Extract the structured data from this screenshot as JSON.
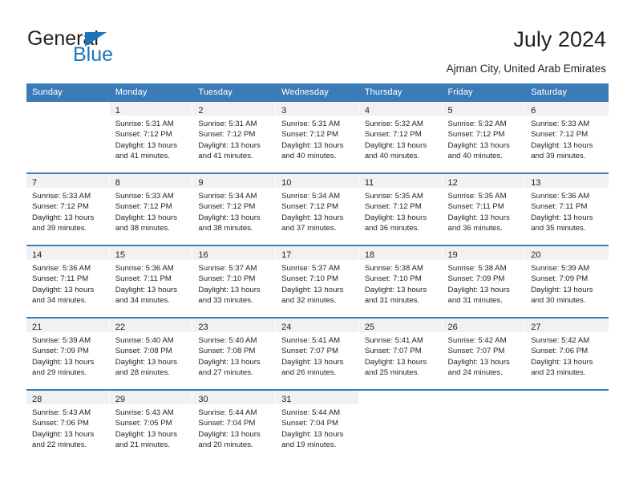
{
  "brand": {
    "name_top": "General",
    "name_bottom": "Blue",
    "accent_color": "#1b75bc"
  },
  "header": {
    "title": "July 2024",
    "subtitle": "Ajman City, United Arab Emirates"
  },
  "calendar": {
    "header_bg": "#3b7cb8",
    "daynum_bg": "#f1f1f1",
    "weekdays": [
      "Sunday",
      "Monday",
      "Tuesday",
      "Wednesday",
      "Thursday",
      "Friday",
      "Saturday"
    ],
    "weeks": [
      [
        {
          "day": "",
          "sunrise": "",
          "sunset": "",
          "daylight_line1": "",
          "daylight_line2": ""
        },
        {
          "day": "1",
          "sunrise": "Sunrise: 5:31 AM",
          "sunset": "Sunset: 7:12 PM",
          "daylight_line1": "Daylight: 13 hours",
          "daylight_line2": "and 41 minutes."
        },
        {
          "day": "2",
          "sunrise": "Sunrise: 5:31 AM",
          "sunset": "Sunset: 7:12 PM",
          "daylight_line1": "Daylight: 13 hours",
          "daylight_line2": "and 41 minutes."
        },
        {
          "day": "3",
          "sunrise": "Sunrise: 5:31 AM",
          "sunset": "Sunset: 7:12 PM",
          "daylight_line1": "Daylight: 13 hours",
          "daylight_line2": "and 40 minutes."
        },
        {
          "day": "4",
          "sunrise": "Sunrise: 5:32 AM",
          "sunset": "Sunset: 7:12 PM",
          "daylight_line1": "Daylight: 13 hours",
          "daylight_line2": "and 40 minutes."
        },
        {
          "day": "5",
          "sunrise": "Sunrise: 5:32 AM",
          "sunset": "Sunset: 7:12 PM",
          "daylight_line1": "Daylight: 13 hours",
          "daylight_line2": "and 40 minutes."
        },
        {
          "day": "6",
          "sunrise": "Sunrise: 5:33 AM",
          "sunset": "Sunset: 7:12 PM",
          "daylight_line1": "Daylight: 13 hours",
          "daylight_line2": "and 39 minutes."
        }
      ],
      [
        {
          "day": "7",
          "sunrise": "Sunrise: 5:33 AM",
          "sunset": "Sunset: 7:12 PM",
          "daylight_line1": "Daylight: 13 hours",
          "daylight_line2": "and 39 minutes."
        },
        {
          "day": "8",
          "sunrise": "Sunrise: 5:33 AM",
          "sunset": "Sunset: 7:12 PM",
          "daylight_line1": "Daylight: 13 hours",
          "daylight_line2": "and 38 minutes."
        },
        {
          "day": "9",
          "sunrise": "Sunrise: 5:34 AM",
          "sunset": "Sunset: 7:12 PM",
          "daylight_line1": "Daylight: 13 hours",
          "daylight_line2": "and 38 minutes."
        },
        {
          "day": "10",
          "sunrise": "Sunrise: 5:34 AM",
          "sunset": "Sunset: 7:12 PM",
          "daylight_line1": "Daylight: 13 hours",
          "daylight_line2": "and 37 minutes."
        },
        {
          "day": "11",
          "sunrise": "Sunrise: 5:35 AM",
          "sunset": "Sunset: 7:12 PM",
          "daylight_line1": "Daylight: 13 hours",
          "daylight_line2": "and 36 minutes."
        },
        {
          "day": "12",
          "sunrise": "Sunrise: 5:35 AM",
          "sunset": "Sunset: 7:11 PM",
          "daylight_line1": "Daylight: 13 hours",
          "daylight_line2": "and 36 minutes."
        },
        {
          "day": "13",
          "sunrise": "Sunrise: 5:36 AM",
          "sunset": "Sunset: 7:11 PM",
          "daylight_line1": "Daylight: 13 hours",
          "daylight_line2": "and 35 minutes."
        }
      ],
      [
        {
          "day": "14",
          "sunrise": "Sunrise: 5:36 AM",
          "sunset": "Sunset: 7:11 PM",
          "daylight_line1": "Daylight: 13 hours",
          "daylight_line2": "and 34 minutes."
        },
        {
          "day": "15",
          "sunrise": "Sunrise: 5:36 AM",
          "sunset": "Sunset: 7:11 PM",
          "daylight_line1": "Daylight: 13 hours",
          "daylight_line2": "and 34 minutes."
        },
        {
          "day": "16",
          "sunrise": "Sunrise: 5:37 AM",
          "sunset": "Sunset: 7:10 PM",
          "daylight_line1": "Daylight: 13 hours",
          "daylight_line2": "and 33 minutes."
        },
        {
          "day": "17",
          "sunrise": "Sunrise: 5:37 AM",
          "sunset": "Sunset: 7:10 PM",
          "daylight_line1": "Daylight: 13 hours",
          "daylight_line2": "and 32 minutes."
        },
        {
          "day": "18",
          "sunrise": "Sunrise: 5:38 AM",
          "sunset": "Sunset: 7:10 PM",
          "daylight_line1": "Daylight: 13 hours",
          "daylight_line2": "and 31 minutes."
        },
        {
          "day": "19",
          "sunrise": "Sunrise: 5:38 AM",
          "sunset": "Sunset: 7:09 PM",
          "daylight_line1": "Daylight: 13 hours",
          "daylight_line2": "and 31 minutes."
        },
        {
          "day": "20",
          "sunrise": "Sunrise: 5:39 AM",
          "sunset": "Sunset: 7:09 PM",
          "daylight_line1": "Daylight: 13 hours",
          "daylight_line2": "and 30 minutes."
        }
      ],
      [
        {
          "day": "21",
          "sunrise": "Sunrise: 5:39 AM",
          "sunset": "Sunset: 7:09 PM",
          "daylight_line1": "Daylight: 13 hours",
          "daylight_line2": "and 29 minutes."
        },
        {
          "day": "22",
          "sunrise": "Sunrise: 5:40 AM",
          "sunset": "Sunset: 7:08 PM",
          "daylight_line1": "Daylight: 13 hours",
          "daylight_line2": "and 28 minutes."
        },
        {
          "day": "23",
          "sunrise": "Sunrise: 5:40 AM",
          "sunset": "Sunset: 7:08 PM",
          "daylight_line1": "Daylight: 13 hours",
          "daylight_line2": "and 27 minutes."
        },
        {
          "day": "24",
          "sunrise": "Sunrise: 5:41 AM",
          "sunset": "Sunset: 7:07 PM",
          "daylight_line1": "Daylight: 13 hours",
          "daylight_line2": "and 26 minutes."
        },
        {
          "day": "25",
          "sunrise": "Sunrise: 5:41 AM",
          "sunset": "Sunset: 7:07 PM",
          "daylight_line1": "Daylight: 13 hours",
          "daylight_line2": "and 25 minutes."
        },
        {
          "day": "26",
          "sunrise": "Sunrise: 5:42 AM",
          "sunset": "Sunset: 7:07 PM",
          "daylight_line1": "Daylight: 13 hours",
          "daylight_line2": "and 24 minutes."
        },
        {
          "day": "27",
          "sunrise": "Sunrise: 5:42 AM",
          "sunset": "Sunset: 7:06 PM",
          "daylight_line1": "Daylight: 13 hours",
          "daylight_line2": "and 23 minutes."
        }
      ],
      [
        {
          "day": "28",
          "sunrise": "Sunrise: 5:43 AM",
          "sunset": "Sunset: 7:06 PM",
          "daylight_line1": "Daylight: 13 hours",
          "daylight_line2": "and 22 minutes."
        },
        {
          "day": "29",
          "sunrise": "Sunrise: 5:43 AM",
          "sunset": "Sunset: 7:05 PM",
          "daylight_line1": "Daylight: 13 hours",
          "daylight_line2": "and 21 minutes."
        },
        {
          "day": "30",
          "sunrise": "Sunrise: 5:44 AM",
          "sunset": "Sunset: 7:04 PM",
          "daylight_line1": "Daylight: 13 hours",
          "daylight_line2": "and 20 minutes."
        },
        {
          "day": "31",
          "sunrise": "Sunrise: 5:44 AM",
          "sunset": "Sunset: 7:04 PM",
          "daylight_line1": "Daylight: 13 hours",
          "daylight_line2": "and 19 minutes."
        },
        {
          "day": "",
          "sunrise": "",
          "sunset": "",
          "daylight_line1": "",
          "daylight_line2": ""
        },
        {
          "day": "",
          "sunrise": "",
          "sunset": "",
          "daylight_line1": "",
          "daylight_line2": ""
        },
        {
          "day": "",
          "sunrise": "",
          "sunset": "",
          "daylight_line1": "",
          "daylight_line2": ""
        }
      ]
    ]
  }
}
